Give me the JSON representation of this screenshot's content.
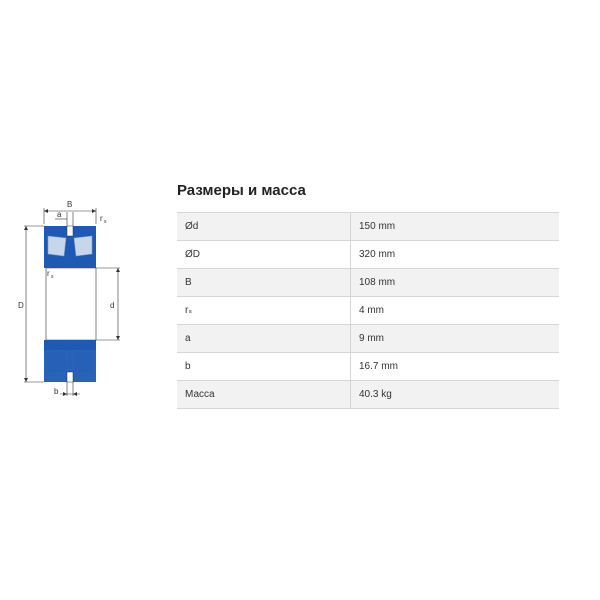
{
  "drawing": {
    "labels": {
      "B": "B",
      "a": "a",
      "rs_top": "r",
      "rs_top_sub": "s",
      "rs_inner": "r",
      "rs_inner_sub": "s",
      "D": "D",
      "d": "d",
      "b": "b"
    },
    "colors": {
      "ring": "#1e5ab4",
      "roller": "#c8d6ea",
      "roller_shade": "#7f9cc7",
      "line": "#333333"
    }
  },
  "panel": {
    "title": "Размеры и масса",
    "rows": [
      {
        "label": "Ød",
        "value": "150 mm"
      },
      {
        "label": "ØD",
        "value": "320 mm"
      },
      {
        "label": "B",
        "value": "108 mm"
      },
      {
        "label": "rₛ",
        "value": "4 mm"
      },
      {
        "label": "a",
        "value": "9 mm"
      },
      {
        "label": "b",
        "value": "16.7 mm"
      },
      {
        "label": "Масса",
        "value": "40.3 kg"
      }
    ]
  }
}
